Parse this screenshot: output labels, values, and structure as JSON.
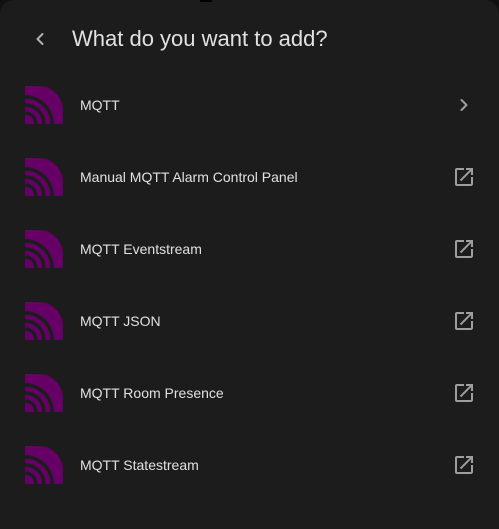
{
  "dialog": {
    "title": "What do you want to add?",
    "back_icon": "chevron-left-icon"
  },
  "colors": {
    "background": "#1c1c1c",
    "text": "#e1e1e1",
    "icon": "#9e9e9e",
    "brand_purple": "#660066"
  },
  "items": [
    {
      "label": "MQTT",
      "logo": "mqtt-logo",
      "trailing_icon": "chevron-right-icon"
    },
    {
      "label": "Manual MQTT Alarm Control Panel",
      "logo": "mqtt-logo",
      "trailing_icon": "open-in-new-icon"
    },
    {
      "label": "MQTT Eventstream",
      "logo": "mqtt-logo",
      "trailing_icon": "open-in-new-icon"
    },
    {
      "label": "MQTT JSON",
      "logo": "mqtt-logo",
      "trailing_icon": "open-in-new-icon"
    },
    {
      "label": "MQTT Room Presence",
      "logo": "mqtt-logo",
      "trailing_icon": "open-in-new-icon"
    },
    {
      "label": "MQTT Statestream",
      "logo": "mqtt-logo",
      "trailing_icon": "open-in-new-icon"
    }
  ]
}
